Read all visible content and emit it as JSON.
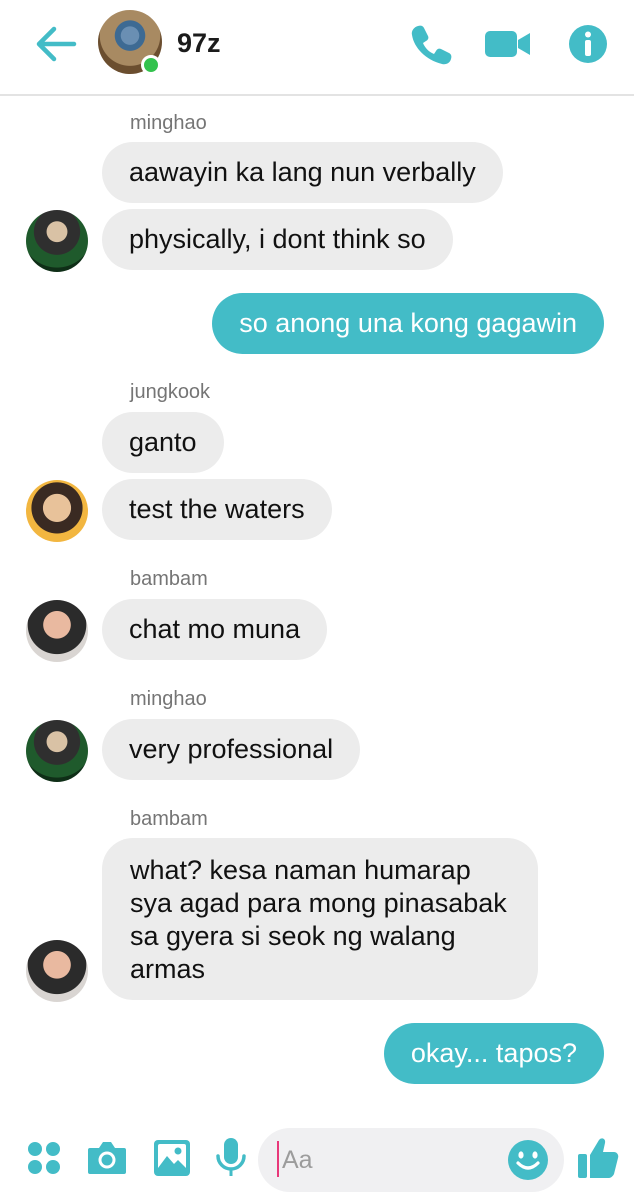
{
  "header": {
    "title": "97z"
  },
  "messages": [
    {
      "sender": "minghao",
      "bubbles": [
        "aawayin ka lang nun verbally",
        "physically, i dont think so"
      ]
    },
    {
      "sender": "me",
      "bubbles": [
        "so anong una kong gagawin"
      ]
    },
    {
      "sender": "jungkook",
      "bubbles": [
        "ganto",
        "test the waters"
      ]
    },
    {
      "sender": "bambam",
      "bubbles": [
        "chat mo muna"
      ]
    },
    {
      "sender": "minghao",
      "bubbles": [
        "very professional"
      ]
    },
    {
      "sender": "bambam",
      "bubbles": [
        "what? kesa naman humarap sya agad para mong pinasabak sa gyera si seok ng walang armas"
      ]
    },
    {
      "sender": "me",
      "bubbles": [
        "okay... tapos?"
      ]
    }
  ],
  "composer": {
    "placeholder": "Aa"
  },
  "colors": {
    "accent": "#43bcc7",
    "incoming_bubble": "#ececec",
    "online": "#33c24d"
  },
  "icons": [
    "back-arrow-icon",
    "phone-icon",
    "video-camera-icon",
    "info-icon",
    "apps-grid-icon",
    "camera-icon",
    "image-icon",
    "microphone-icon",
    "emoji-icon",
    "thumbs-up-icon"
  ]
}
